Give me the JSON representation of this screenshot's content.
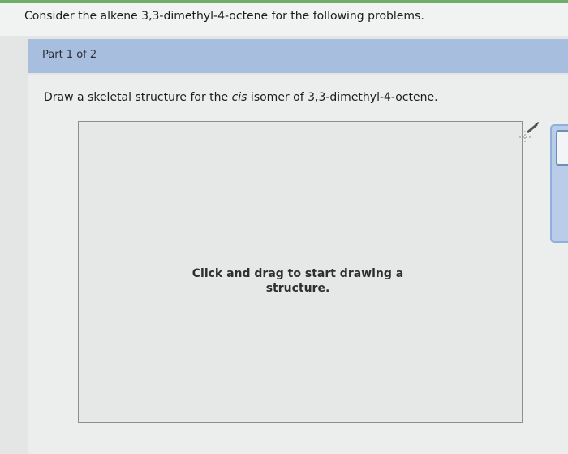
{
  "question": {
    "text": "Consider the alkene 3,3-dimethyl-4-octene for the following problems."
  },
  "part": {
    "label": "Part 1 of 2"
  },
  "instruction": {
    "prefix": "Draw a skeletal structure for the ",
    "emphasis": "cis",
    "suffix": " isomer of 3,3-dimethyl-4-octene."
  },
  "canvas": {
    "prompt": "Click and drag to start drawing a structure."
  },
  "icons": {
    "tool": "pencil-crosshair-icon"
  },
  "colors": {
    "accent_bar": "#a7bedf",
    "top_strip": "#6fae6a",
    "side_panel": "#b9cde8"
  }
}
